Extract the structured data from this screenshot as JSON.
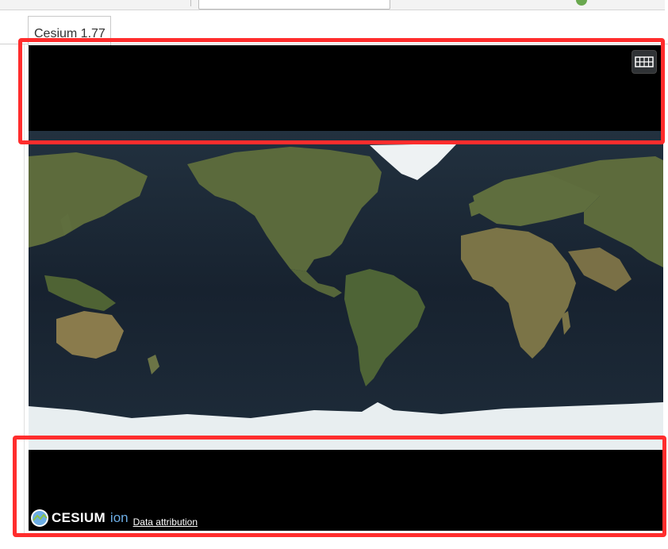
{
  "tab": {
    "label": "Cesium 1.77"
  },
  "viewer": {
    "base_layer_picker": {
      "icon": "grid-icon"
    },
    "credits": {
      "logo_text": "CESIUM",
      "logo_suffix": "ion",
      "data_attribution": "Data attribution"
    }
  },
  "colors": {
    "ocean": "#1a2636",
    "land": "#5c6b3a",
    "ice": "#e8eef0",
    "highlight": "#ff2d2d",
    "ion_blue": "#6cade5"
  }
}
